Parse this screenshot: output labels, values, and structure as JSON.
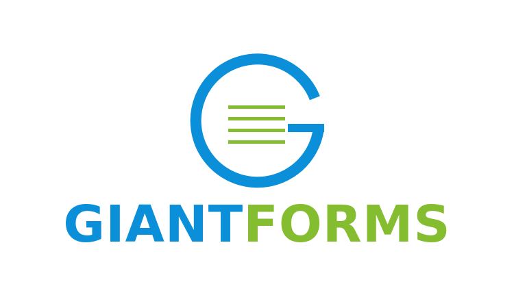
{
  "logo": {
    "wordmark_primary": "GIANT",
    "wordmark_secondary": "FORMS",
    "icon": "g-letter-with-form-lines-icon",
    "colors": {
      "blue": "#0b8fd8",
      "green": "#84bd2f",
      "background": "#ffffff"
    }
  }
}
